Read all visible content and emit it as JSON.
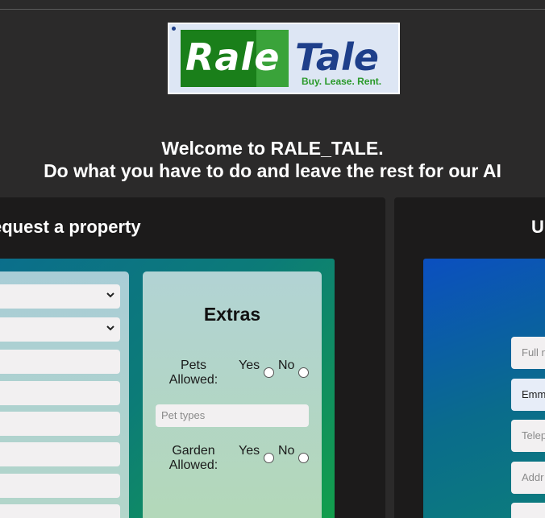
{
  "logo": {
    "word1": "Rale",
    "word2": "Tale",
    "tagline": "Buy. Lease. Rent."
  },
  "welcome": {
    "line1": "Welcome to RALE_TALE.",
    "line2": "Do what you have to do and leave the rest for our AI"
  },
  "left_panel": {
    "title": "equest a property",
    "selects": [
      "",
      ""
    ],
    "inputs": [
      "",
      "",
      "",
      "",
      "",
      ""
    ]
  },
  "extras": {
    "title": "Extras",
    "pets_label": "Pets Allowed:",
    "garden_label": "Garden Allowed:",
    "yes": "Yes",
    "no": "No",
    "pet_types_placeholder": "Pet types"
  },
  "right_panel": {
    "title": "U",
    "fields": [
      {
        "placeholder": "Full n",
        "value": ""
      },
      {
        "placeholder": "",
        "value": "Emm"
      },
      {
        "placeholder": "Telep",
        "value": ""
      },
      {
        "placeholder": "Addr",
        "value": ""
      }
    ]
  },
  "colors": {
    "background": "#2b2a2a",
    "panel": "#1c1b1b",
    "logo_green": "#1a7f1a",
    "logo_blue": "#1e3f8a"
  }
}
